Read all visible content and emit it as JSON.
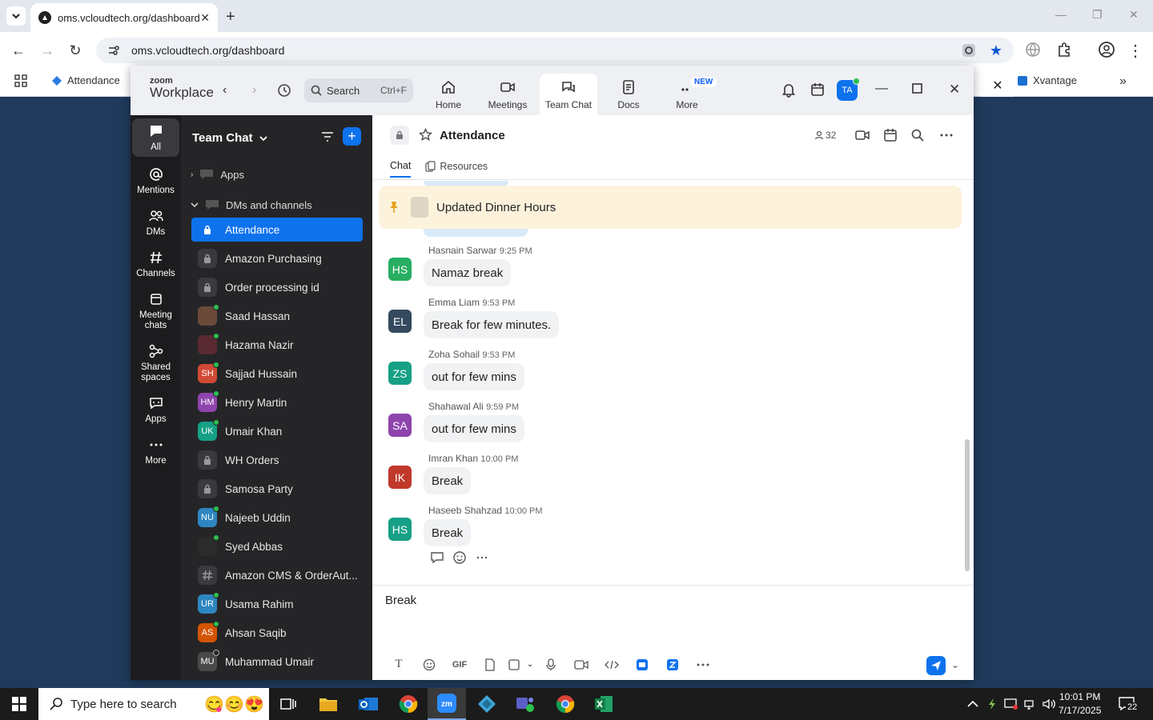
{
  "browser": {
    "tab_title": "oms.vcloudtech.org/dashboard",
    "url": "oms.vcloudtech.org/dashboard",
    "bookmarks": [
      {
        "label": "Attendance"
      },
      {
        "label": "Xvantage"
      }
    ]
  },
  "zoom": {
    "logo_top": "zoom",
    "logo_bottom": "Workplace",
    "search_placeholder": "Search",
    "search_shortcut": "Ctrl+F",
    "nav": [
      {
        "label": "Home",
        "icon": "home-icon"
      },
      {
        "label": "Meetings",
        "icon": "meetings-icon"
      },
      {
        "label": "Team Chat",
        "icon": "chat-icon"
      },
      {
        "label": "Docs",
        "icon": "docs-icon"
      },
      {
        "label": "More",
        "icon": "more-icon"
      }
    ],
    "new_badge": "NEW",
    "user_initials": "TA"
  },
  "rail": [
    {
      "label": "All",
      "icon": "chat-bubble-icon"
    },
    {
      "label": "Mentions",
      "icon": "at-icon"
    },
    {
      "label": "DMs",
      "icon": "people-icon"
    },
    {
      "label": "Channels",
      "icon": "hash-icon"
    },
    {
      "label": "Meeting chats",
      "icon": "calendar-icon"
    },
    {
      "label": "Shared spaces",
      "icon": "share-icon"
    },
    {
      "label": "Apps",
      "icon": "apps-icon"
    },
    {
      "label": "More",
      "icon": "ellipsis-icon"
    }
  ],
  "sidebar": {
    "title": "Team Chat",
    "groups": {
      "apps": "Apps",
      "dms": "DMs and channels"
    },
    "items": [
      {
        "label": "Attendance",
        "type": "lock",
        "active": true
      },
      {
        "label": "Amazon Purchasing",
        "type": "lock"
      },
      {
        "label": "Order processing id",
        "type": "lock"
      },
      {
        "label": "Saad Hassan",
        "type": "photo",
        "color": "#6b4a3a",
        "online": true
      },
      {
        "label": "Hazama Nazir",
        "type": "photo",
        "color": "#5a2a33",
        "online": true
      },
      {
        "label": "Sajjad Hussain",
        "type": "initials",
        "initials": "SH",
        "color": "#d04a35",
        "online": true
      },
      {
        "label": "Henry Martin",
        "type": "initials",
        "initials": "HM",
        "color": "#8e44ad",
        "online": true
      },
      {
        "label": "Umair Khan",
        "type": "initials",
        "initials": "UK",
        "color": "#16a085",
        "online": true
      },
      {
        "label": "WH Orders",
        "type": "lock"
      },
      {
        "label": "Samosa Party",
        "type": "lock"
      },
      {
        "label": "Najeeb Uddin",
        "type": "initials",
        "initials": "NU",
        "color": "#2e86c1",
        "online": true
      },
      {
        "label": "Syed Abbas",
        "type": "photo",
        "color": "#2b2b2b",
        "online": true
      },
      {
        "label": "Amazon CMS & OrderAut...",
        "type": "hash"
      },
      {
        "label": "Usama Rahim",
        "type": "initials",
        "initials": "UR",
        "color": "#2e86c1",
        "online": true
      },
      {
        "label": "Ahsan Saqib",
        "type": "initials",
        "initials": "AS",
        "color": "#d35400",
        "online": true
      },
      {
        "label": "Muhammad Umair",
        "type": "initials",
        "initials": "MU",
        "color": "#4a4a4a",
        "online": false
      }
    ]
  },
  "channel": {
    "name": "Attendance",
    "member_count": "32",
    "tabs": [
      "Chat",
      "Resources"
    ],
    "pinned": "Updated Dinner Hours",
    "messages": [
      {
        "initials": "HS",
        "name": "Hasnain Sarwar",
        "time": "9:25 PM",
        "text": "Namaz break",
        "color": "#27ae60"
      },
      {
        "initials": "EL",
        "name": "Emma Liam",
        "time": "9:53 PM",
        "text": "Break for few minutes.",
        "color": "#34495e"
      },
      {
        "initials": "ZS",
        "name": "Zoha Sohail",
        "time": "9:53 PM",
        "text": "out for few mins",
        "color": "#16a085"
      },
      {
        "initials": "SA",
        "name": "Shahawal Ali",
        "time": "9:59 PM",
        "text": "out for few mins",
        "color": "#8e44ad"
      },
      {
        "initials": "IK",
        "name": "Imran Khan",
        "time": "10:00 PM",
        "text": "Break",
        "color": "#c0392b"
      },
      {
        "initials": "HS",
        "name": "Haseeb Shahzad",
        "time": "10:00 PM",
        "text": "Break",
        "color": "#16a085"
      }
    ],
    "composer_text": "Break",
    "gif_label": "GIF"
  },
  "taskbar": {
    "search_placeholder": "Type here to search",
    "time": "10:01 PM",
    "date": "7/17/2025",
    "notifications": "22"
  }
}
